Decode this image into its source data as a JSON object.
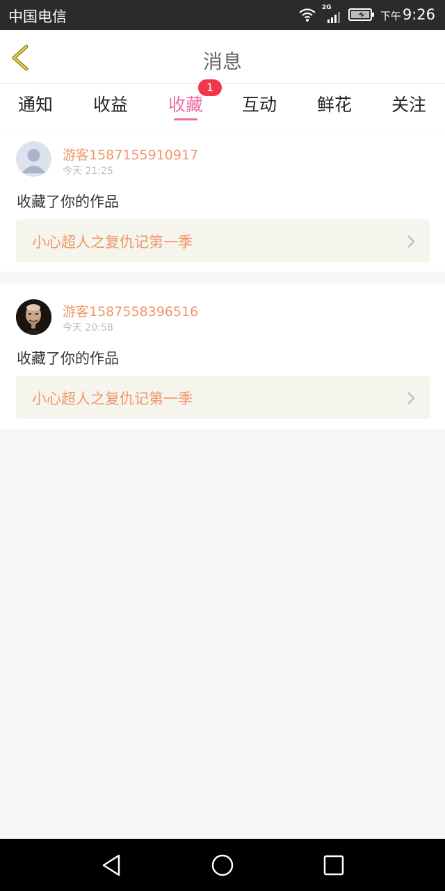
{
  "status_bar": {
    "carrier": "中国电信",
    "network": "2G",
    "time_prefix": "下午",
    "time": "9:26"
  },
  "header": {
    "title": "消息",
    "back_icon": "chevron-left-icon"
  },
  "tabs": [
    {
      "label": "通知",
      "active": false
    },
    {
      "label": "收益",
      "active": false
    },
    {
      "label": "收藏",
      "active": true,
      "badge": "1"
    },
    {
      "label": "互动",
      "active": false
    },
    {
      "label": "鲜花",
      "active": false
    },
    {
      "label": "关注",
      "active": false
    }
  ],
  "colors": {
    "accent": "#ef6ea4",
    "badge": "#f2364a",
    "username": "#f0966a"
  },
  "messages": [
    {
      "username": "游客1587155910917",
      "time": "今天 21:25",
      "action": "收藏了你的作品",
      "work_title": "小心超人之复仇记第一季",
      "avatar": "default-avatar-icon"
    },
    {
      "username": "游客1587558396516",
      "time": "今天 20:58",
      "action": "收藏了你的作品",
      "work_title": "小心超人之复仇记第一季",
      "avatar": "photo-avatar"
    }
  ],
  "nav_bar": {
    "buttons": [
      "back-triangle-icon",
      "home-circle-icon",
      "recents-square-icon"
    ]
  }
}
